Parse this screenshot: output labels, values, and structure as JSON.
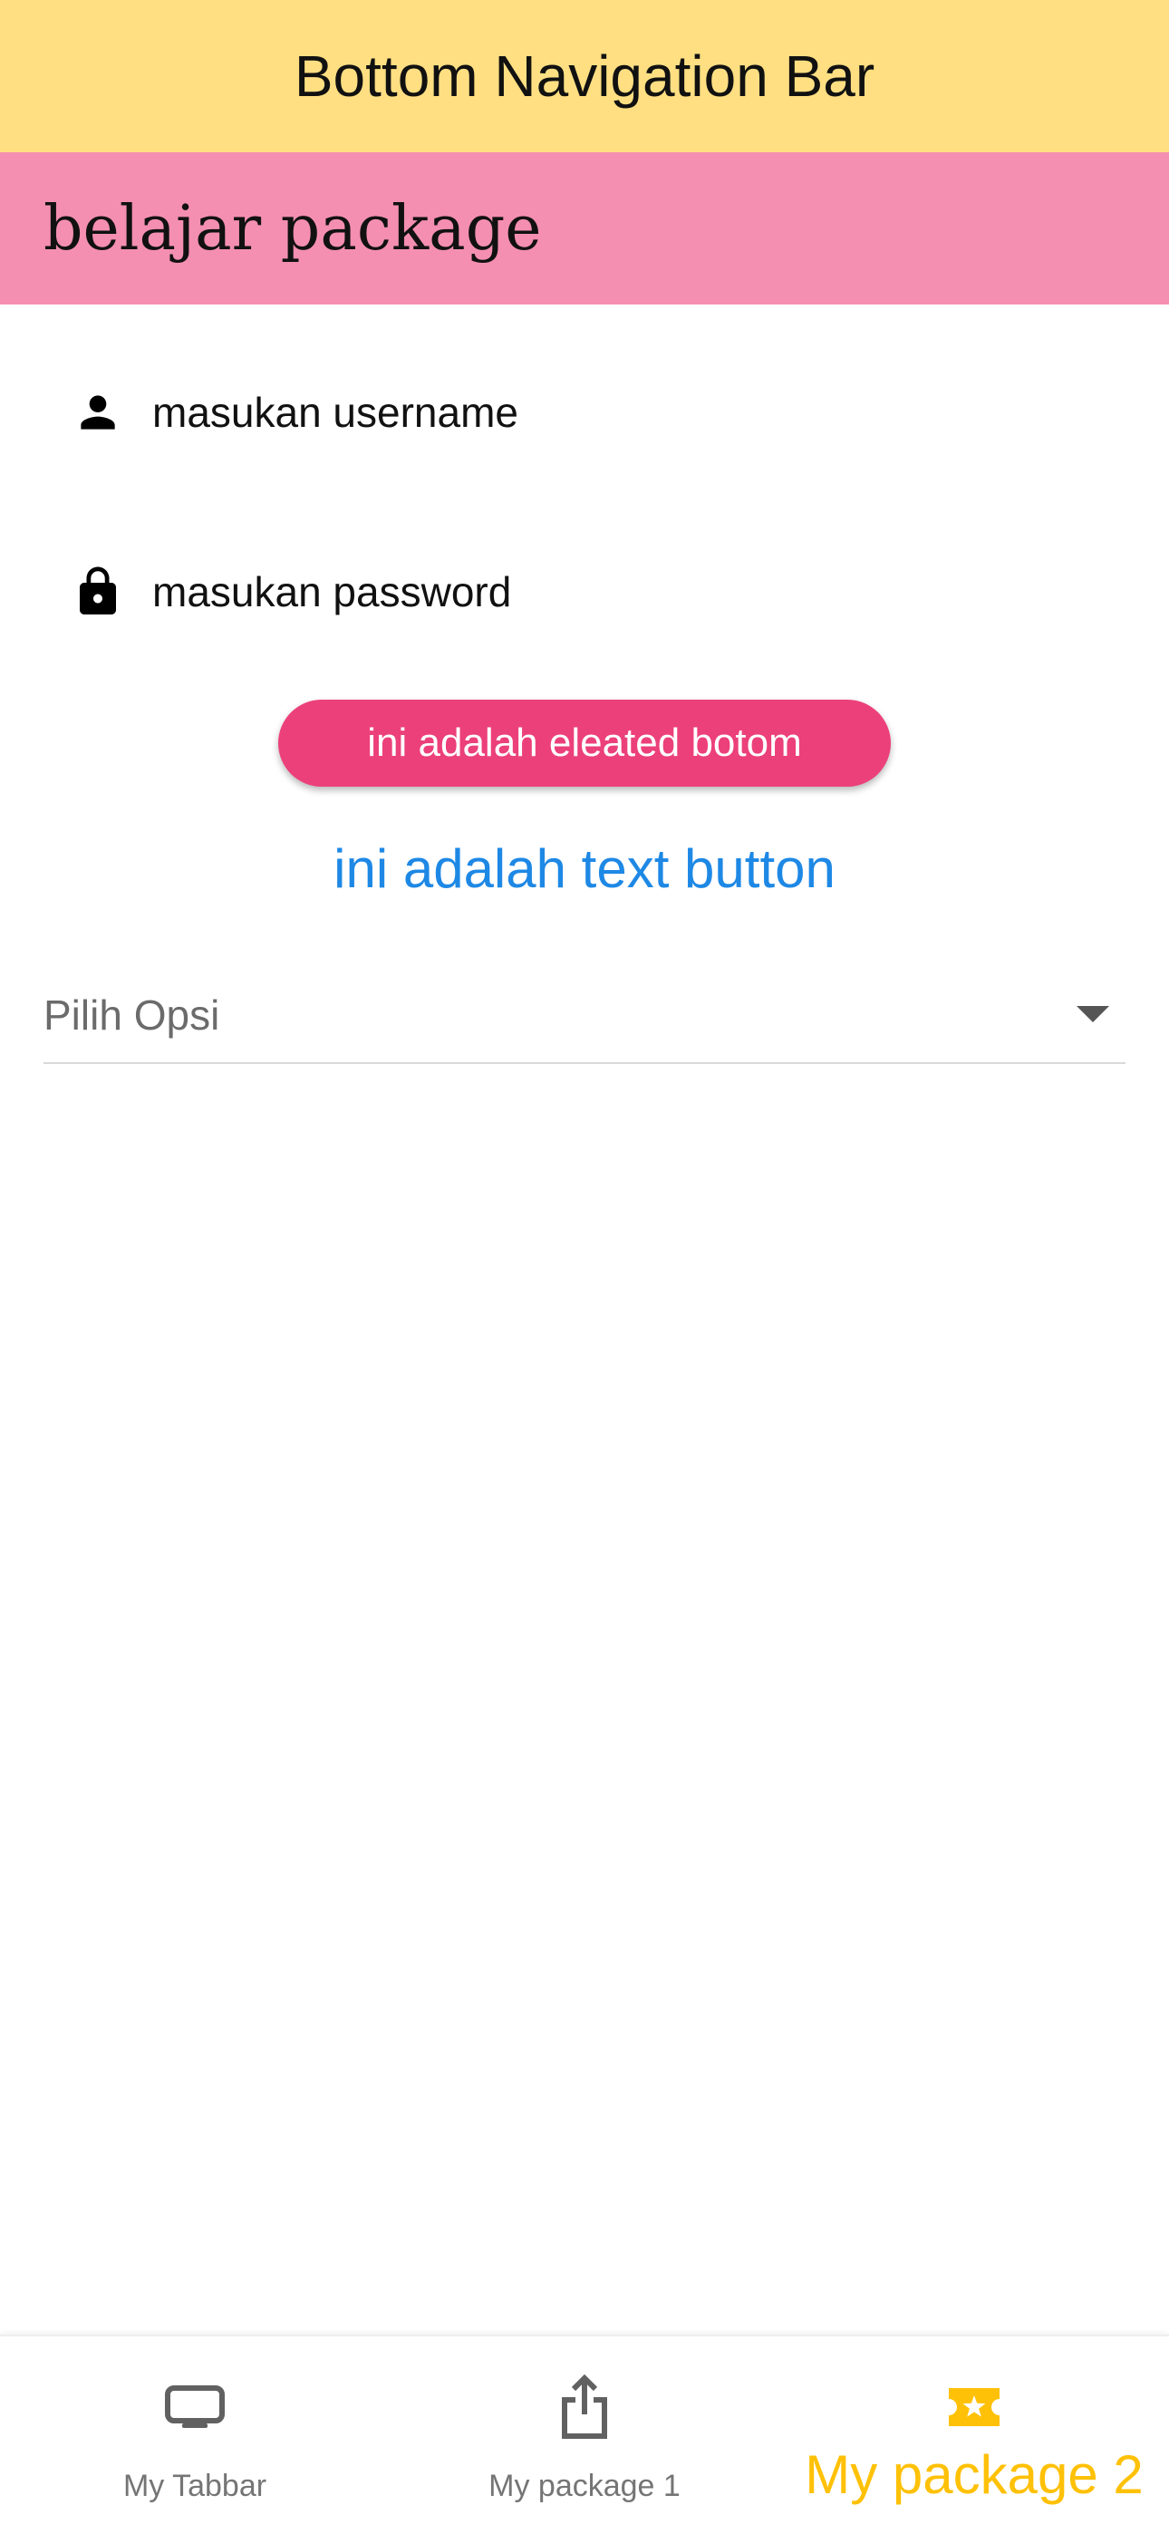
{
  "app_bar": {
    "title": "Bottom Navigation Bar",
    "background": "#FFDF82"
  },
  "section_bar": {
    "title": "belajar package",
    "background": "#F48FB1"
  },
  "form": {
    "username": {
      "icon": "person-icon",
      "hint": "masukan username"
    },
    "password": {
      "icon": "lock-icon",
      "hint": "masukan password"
    },
    "elevated_button": {
      "label": "ini adalah eleated botom",
      "color": "#EC407A"
    },
    "text_button": {
      "label": "ini adalah text button",
      "color": "#1E88E5"
    },
    "dropdown": {
      "hint": "Pilih Opsi",
      "icon": "arrow-drop-down-icon"
    }
  },
  "bottom_nav": {
    "items": [
      {
        "label": "My Tabbar",
        "icon": "tv-icon",
        "active": false
      },
      {
        "label": "My package 1",
        "icon": "share-icon",
        "active": false
      },
      {
        "label": "My package 2",
        "icon": "local-activity-icon",
        "active": true
      }
    ],
    "active_color": "#FFC107",
    "inactive_color": "#757575"
  }
}
